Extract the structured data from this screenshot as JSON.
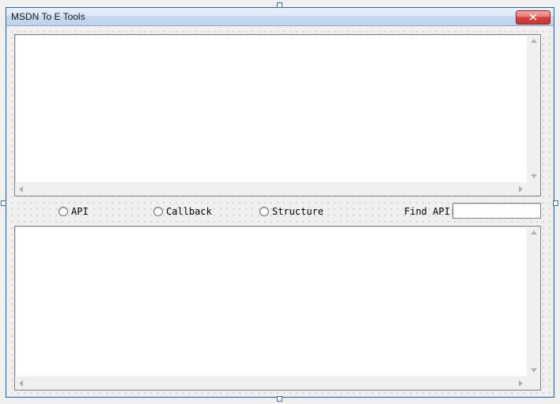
{
  "window": {
    "title": "MSDN To E Tools"
  },
  "panel_top": {
    "value": ""
  },
  "panel_bottom": {
    "value": ""
  },
  "options": {
    "radio1": "API",
    "radio2": "Callback",
    "radio3": "Structure",
    "find_label": "Find API:",
    "find_value": ""
  },
  "icons": {
    "close": "close"
  }
}
